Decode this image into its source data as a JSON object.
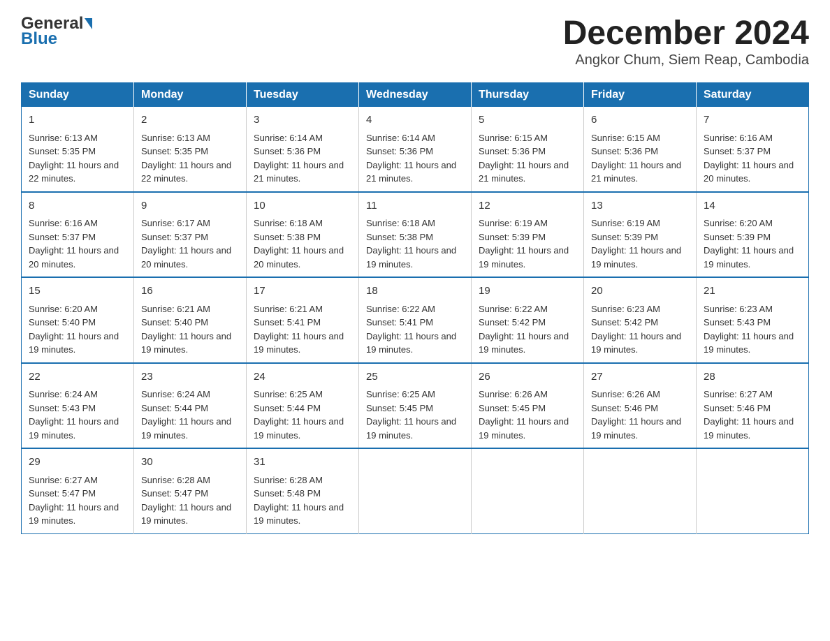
{
  "logo": {
    "general": "General",
    "blue": "Blue",
    "triangle_symbol": "▲"
  },
  "title": "December 2024",
  "subtitle": "Angkor Chum, Siem Reap, Cambodia",
  "days_of_week": [
    "Sunday",
    "Monday",
    "Tuesday",
    "Wednesday",
    "Thursday",
    "Friday",
    "Saturday"
  ],
  "weeks": [
    [
      {
        "day": "1",
        "sunrise": "6:13 AM",
        "sunset": "5:35 PM",
        "daylight": "11 hours and 22 minutes."
      },
      {
        "day": "2",
        "sunrise": "6:13 AM",
        "sunset": "5:35 PM",
        "daylight": "11 hours and 22 minutes."
      },
      {
        "day": "3",
        "sunrise": "6:14 AM",
        "sunset": "5:36 PM",
        "daylight": "11 hours and 21 minutes."
      },
      {
        "day": "4",
        "sunrise": "6:14 AM",
        "sunset": "5:36 PM",
        "daylight": "11 hours and 21 minutes."
      },
      {
        "day": "5",
        "sunrise": "6:15 AM",
        "sunset": "5:36 PM",
        "daylight": "11 hours and 21 minutes."
      },
      {
        "day": "6",
        "sunrise": "6:15 AM",
        "sunset": "5:36 PM",
        "daylight": "11 hours and 21 minutes."
      },
      {
        "day": "7",
        "sunrise": "6:16 AM",
        "sunset": "5:37 PM",
        "daylight": "11 hours and 20 minutes."
      }
    ],
    [
      {
        "day": "8",
        "sunrise": "6:16 AM",
        "sunset": "5:37 PM",
        "daylight": "11 hours and 20 minutes."
      },
      {
        "day": "9",
        "sunrise": "6:17 AM",
        "sunset": "5:37 PM",
        "daylight": "11 hours and 20 minutes."
      },
      {
        "day": "10",
        "sunrise": "6:18 AM",
        "sunset": "5:38 PM",
        "daylight": "11 hours and 20 minutes."
      },
      {
        "day": "11",
        "sunrise": "6:18 AM",
        "sunset": "5:38 PM",
        "daylight": "11 hours and 19 minutes."
      },
      {
        "day": "12",
        "sunrise": "6:19 AM",
        "sunset": "5:39 PM",
        "daylight": "11 hours and 19 minutes."
      },
      {
        "day": "13",
        "sunrise": "6:19 AM",
        "sunset": "5:39 PM",
        "daylight": "11 hours and 19 minutes."
      },
      {
        "day": "14",
        "sunrise": "6:20 AM",
        "sunset": "5:39 PM",
        "daylight": "11 hours and 19 minutes."
      }
    ],
    [
      {
        "day": "15",
        "sunrise": "6:20 AM",
        "sunset": "5:40 PM",
        "daylight": "11 hours and 19 minutes."
      },
      {
        "day": "16",
        "sunrise": "6:21 AM",
        "sunset": "5:40 PM",
        "daylight": "11 hours and 19 minutes."
      },
      {
        "day": "17",
        "sunrise": "6:21 AM",
        "sunset": "5:41 PM",
        "daylight": "11 hours and 19 minutes."
      },
      {
        "day": "18",
        "sunrise": "6:22 AM",
        "sunset": "5:41 PM",
        "daylight": "11 hours and 19 minutes."
      },
      {
        "day": "19",
        "sunrise": "6:22 AM",
        "sunset": "5:42 PM",
        "daylight": "11 hours and 19 minutes."
      },
      {
        "day": "20",
        "sunrise": "6:23 AM",
        "sunset": "5:42 PM",
        "daylight": "11 hours and 19 minutes."
      },
      {
        "day": "21",
        "sunrise": "6:23 AM",
        "sunset": "5:43 PM",
        "daylight": "11 hours and 19 minutes."
      }
    ],
    [
      {
        "day": "22",
        "sunrise": "6:24 AM",
        "sunset": "5:43 PM",
        "daylight": "11 hours and 19 minutes."
      },
      {
        "day": "23",
        "sunrise": "6:24 AM",
        "sunset": "5:44 PM",
        "daylight": "11 hours and 19 minutes."
      },
      {
        "day": "24",
        "sunrise": "6:25 AM",
        "sunset": "5:44 PM",
        "daylight": "11 hours and 19 minutes."
      },
      {
        "day": "25",
        "sunrise": "6:25 AM",
        "sunset": "5:45 PM",
        "daylight": "11 hours and 19 minutes."
      },
      {
        "day": "26",
        "sunrise": "6:26 AM",
        "sunset": "5:45 PM",
        "daylight": "11 hours and 19 minutes."
      },
      {
        "day": "27",
        "sunrise": "6:26 AM",
        "sunset": "5:46 PM",
        "daylight": "11 hours and 19 minutes."
      },
      {
        "day": "28",
        "sunrise": "6:27 AM",
        "sunset": "5:46 PM",
        "daylight": "11 hours and 19 minutes."
      }
    ],
    [
      {
        "day": "29",
        "sunrise": "6:27 AM",
        "sunset": "5:47 PM",
        "daylight": "11 hours and 19 minutes."
      },
      {
        "day": "30",
        "sunrise": "6:28 AM",
        "sunset": "5:47 PM",
        "daylight": "11 hours and 19 minutes."
      },
      {
        "day": "31",
        "sunrise": "6:28 AM",
        "sunset": "5:48 PM",
        "daylight": "11 hours and 19 minutes."
      },
      null,
      null,
      null,
      null
    ]
  ]
}
